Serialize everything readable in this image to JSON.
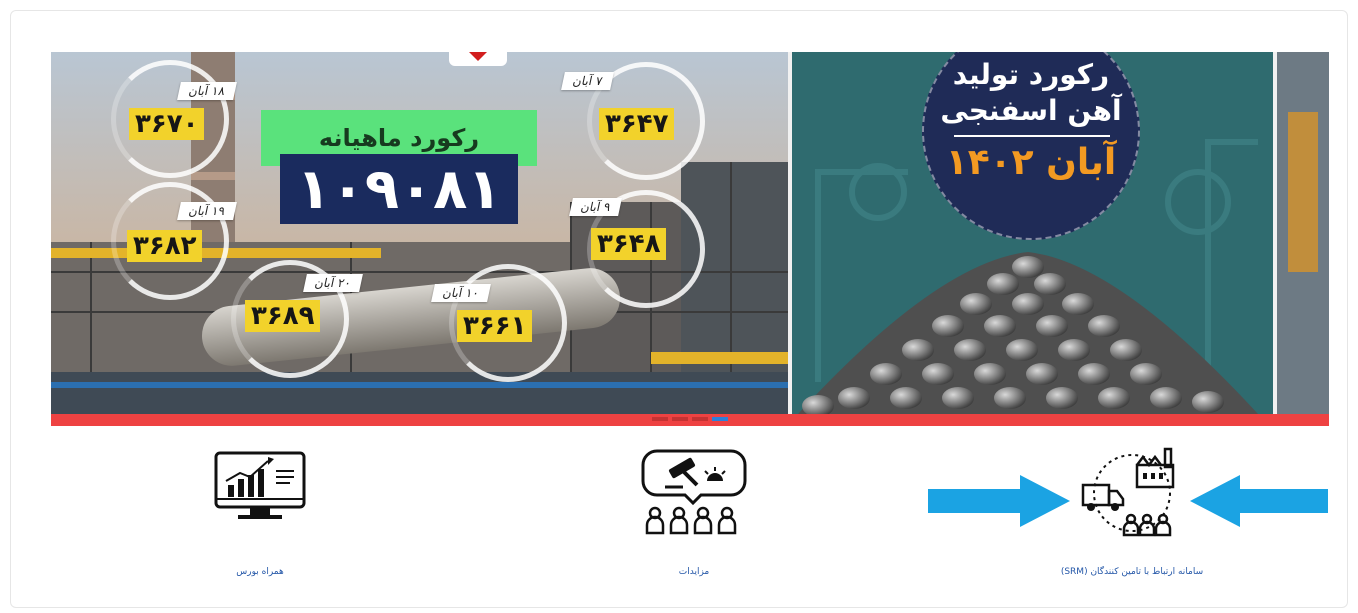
{
  "banner": {
    "slide_left": {
      "record_title": "رکورد ماهیانه",
      "record_value": "۱۰۹۰۸۱",
      "days": [
        {
          "date": "۱۸ آبان",
          "value": "۳۶۷۰"
        },
        {
          "date": "۱۹ آبان",
          "value": "۳۶۸۲"
        },
        {
          "date": "۲۰ آبان",
          "value": "۳۶۸۹"
        },
        {
          "date": "۱۰ آبان",
          "value": "۳۶۶۱"
        },
        {
          "date": "۹ آبان",
          "value": "۳۶۴۸"
        },
        {
          "date": "۷ آبان",
          "value": "۳۶۴۷"
        }
      ]
    },
    "slide_right": {
      "line1": "رکورد تولید",
      "line2": "آهن اسفنجی",
      "line3": "آبان ۱۴۰۲"
    },
    "dots_count": 4,
    "active_dot": 3
  },
  "services": [
    {
      "label": "همراه بورس",
      "icon": "stock-monitor-icon"
    },
    {
      "label": "مزایدات",
      "icon": "auction-icon"
    },
    {
      "label": "سامانه ارتباط با تامین کنندگان (SRM)",
      "icon": "supplier-relations-icon"
    }
  ],
  "colors": {
    "accent_strip": "#ee4242",
    "active_dot": "#2f7fd8",
    "arrow": "#1ba3e3",
    "link": "#2457a8",
    "record_green": "#5ae27c",
    "record_navy": "#1a2b5e",
    "value_yellow": "#f2d22b",
    "badge_orange": "#f39a22"
  }
}
